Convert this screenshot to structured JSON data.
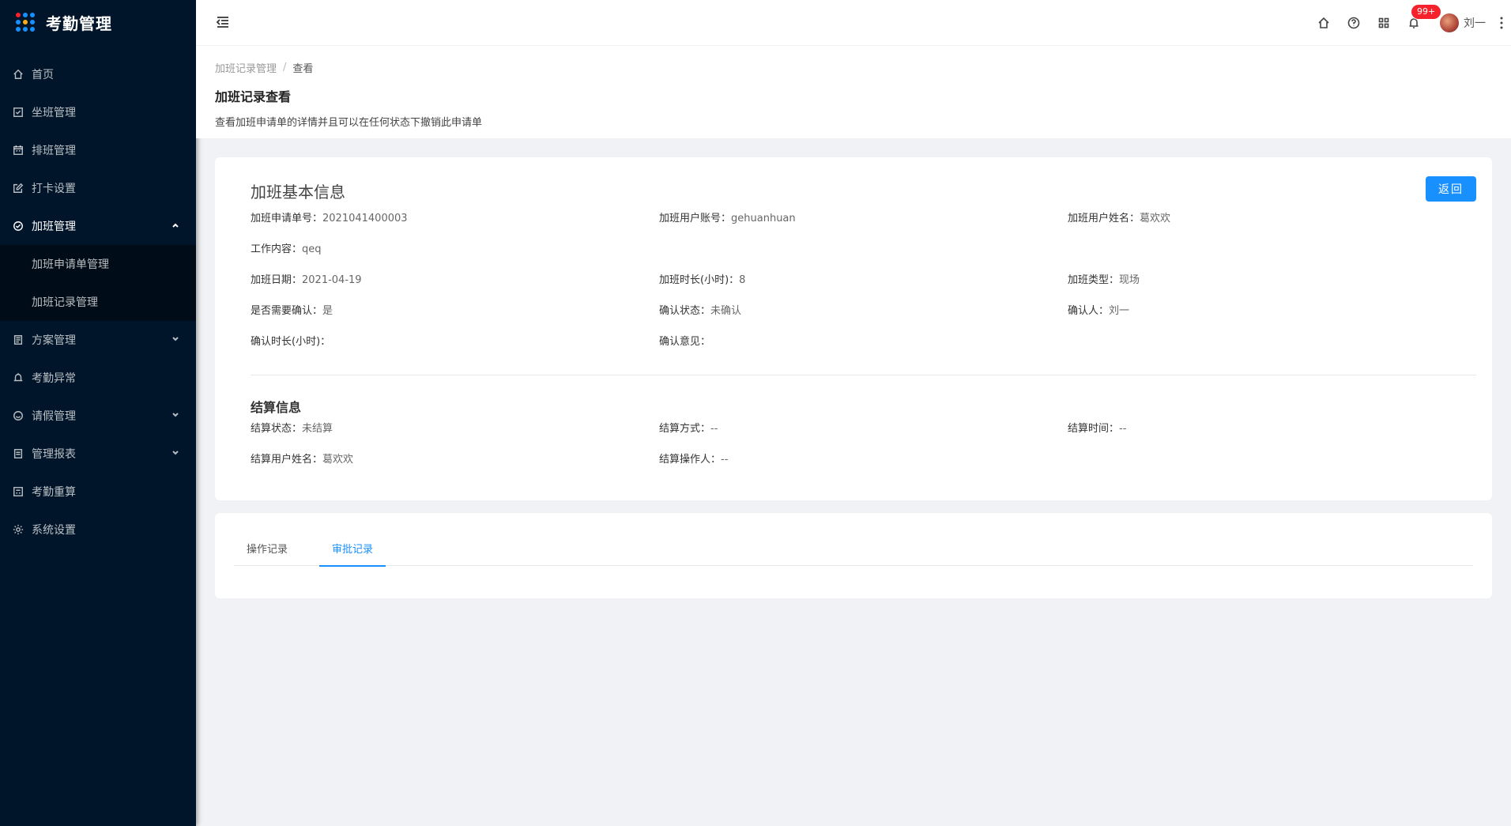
{
  "app": {
    "title": "考勤管理"
  },
  "sidebar": {
    "items": [
      {
        "label": "首页",
        "icon": "home-icon"
      },
      {
        "label": "坐班管理",
        "icon": "calendar-check-icon"
      },
      {
        "label": "排班管理",
        "icon": "schedule-icon"
      },
      {
        "label": "打卡设置",
        "icon": "edit-icon"
      },
      {
        "label": "加班管理",
        "icon": "clock-icon",
        "expanded": true,
        "children": [
          {
            "label": "加班申请单管理"
          },
          {
            "label": "加班记录管理"
          }
        ]
      },
      {
        "label": "方案管理",
        "icon": "document-icon"
      },
      {
        "label": "考勤异常",
        "icon": "alarm-icon"
      },
      {
        "label": "请假管理",
        "icon": "leave-icon"
      },
      {
        "label": "管理报表",
        "icon": "report-icon"
      },
      {
        "label": "考勤重算",
        "icon": "recalc-icon"
      },
      {
        "label": "系统设置",
        "icon": "gear-icon"
      }
    ]
  },
  "header": {
    "badge": "99+",
    "user_name": "刘一"
  },
  "breadcrumb": {
    "parent": "加班记录管理",
    "current": "查看"
  },
  "page": {
    "title": "加班记录查看",
    "description": "查看加班申请单的详情并且可以在任何状态下撤销此申请单"
  },
  "basic_info": {
    "title": "加班基本信息",
    "back_label": "返回",
    "fields": [
      {
        "label": "加班申请单号：",
        "value": "2021041400003"
      },
      {
        "label": "加班用户账号：",
        "value": "gehuanhuan"
      },
      {
        "label": "加班用户姓名：",
        "value": "葛欢欢"
      },
      {
        "label": "工作内容：",
        "value": "qeq"
      },
      {
        "label": "加班日期：",
        "value": "2021-04-19"
      },
      {
        "label": "加班时长(小时)：",
        "value": "8"
      },
      {
        "label": "加班类型：",
        "value": "现场"
      },
      {
        "label": "是否需要确认：",
        "value": "是"
      },
      {
        "label": "确认状态：",
        "value": "未确认"
      },
      {
        "label": "确认人：",
        "value": "刘一"
      },
      {
        "label": "确认时长(小时)：",
        "value": ""
      },
      {
        "label": "确认意见：",
        "value": ""
      }
    ]
  },
  "settlement": {
    "title": "结算信息",
    "fields": [
      {
        "label": "结算状态：",
        "value": "未结算"
      },
      {
        "label": "结算方式：",
        "value": "--"
      },
      {
        "label": "结算时间：",
        "value": "--"
      },
      {
        "label": "结算用户姓名：",
        "value": "葛欢欢"
      },
      {
        "label": "结算操作人：",
        "value": "--"
      }
    ]
  },
  "tabs": [
    {
      "label": "操作记录",
      "active": false
    },
    {
      "label": "审批记录",
      "active": true
    }
  ],
  "colors": {
    "primary": "#1890ff",
    "sidebar": "#001529",
    "badge": "#f5222d"
  }
}
